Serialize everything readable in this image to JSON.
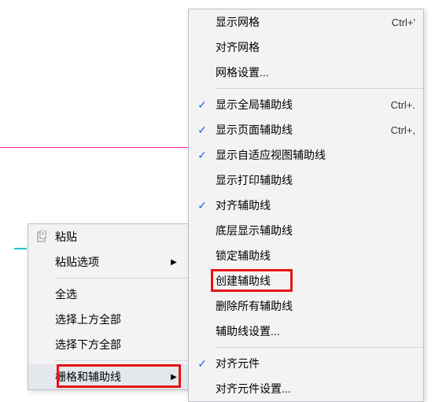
{
  "leftMenu": {
    "paste": "粘贴",
    "pasteOptions": "粘贴选项",
    "selectAll": "全选",
    "selectAbove": "选择上方全部",
    "selectBelow": "选择下方全部",
    "gridGuides": "栅格和辅助线"
  },
  "rightMenu": {
    "showGrid": {
      "label": "显示网格",
      "shortcut": "Ctrl+'"
    },
    "alignGrid": "对齐网格",
    "gridSettings": "网格设置...",
    "showGlobalGuides": {
      "label": "显示全局辅助线",
      "shortcut": "Ctrl+."
    },
    "showPageGuides": {
      "label": "显示页面辅助线",
      "shortcut": "Ctrl+,"
    },
    "showAdaptiveGuides": "显示自适应视图辅助线",
    "showPrintGuides": "显示打印辅助线",
    "alignGuides": "对齐辅助线",
    "bottomLayerGuides": "底层显示辅助线",
    "lockGuides": "锁定辅助线",
    "createGuide": "创建辅助线",
    "deleteAllGuides": "删除所有辅助线",
    "guideSettings": "辅助线设置...",
    "alignElements": "对齐元件",
    "alignElementSettings": "对齐元件设置..."
  }
}
